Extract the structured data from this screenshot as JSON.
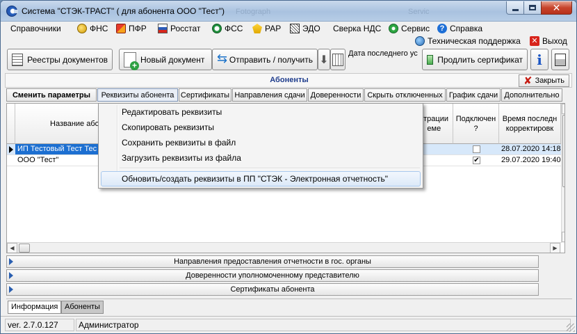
{
  "window": {
    "title": "Система \"СТЭК-ТРАСТ\" ( для абонента ООО \"Тест\")",
    "watermark_left": "Fotograph",
    "watermark_right": "Servic"
  },
  "menu": {
    "items": [
      {
        "label": "Справочники",
        "icon": "book-icon"
      },
      {
        "label": "ФНС",
        "icon": "fns-emblem-icon"
      },
      {
        "label": "ПФР",
        "icon": "pfr-logo-icon"
      },
      {
        "label": "Росстат",
        "icon": "rosstat-logo-icon"
      },
      {
        "label": "ФСС",
        "icon": "fss-logo-icon"
      },
      {
        "label": "РАР",
        "icon": "rar-emblem-icon"
      },
      {
        "label": "ЭДО",
        "icon": "edo-icon"
      },
      {
        "label": "Сверка НДС",
        "icon": ""
      },
      {
        "label": "Сервис",
        "icon": "gear-icon"
      },
      {
        "label": "Справка",
        "icon": "help-icon"
      }
    ],
    "support": "Техническая поддержка",
    "exit": "Выход"
  },
  "toolbar": {
    "registers": "Реестры документов",
    "new_document": "Новый документ",
    "send_receive": "Отправить / получить",
    "last_date_label": "Дата последнего ус",
    "extend_certificate": "Продлить сертификат"
  },
  "panel": {
    "title": "Абоненты",
    "close": "Закрыть"
  },
  "subtabs": [
    "Сменить параметры",
    "Реквизиты абонента",
    "Сертификаты",
    "Направления сдачи",
    "Доверенности",
    "Скрыть отключенных",
    "График сдачи",
    "Дополнительно"
  ],
  "grid": {
    "headers": {
      "name": "Название або",
      "registration": "страции\nеме",
      "connected": "Подключен\n?",
      "modified": "Время последн\nкорректировк"
    },
    "rows": [
      {
        "name": "ИП Тестовый Тест Тес",
        "connected": false,
        "modified": "28.07.2020 14:18",
        "selected": true
      },
      {
        "name": "ООО \"Тест\"",
        "connected": true,
        "modified": "29.07.2020 19:40",
        "selected": false
      }
    ]
  },
  "context_menu": {
    "items": [
      "Редактировать реквизиты",
      "Скопировать реквизиты",
      "Сохранить реквизиты в файл",
      "Загрузить реквизиты из файла"
    ],
    "highlighted": "Обновить/создать реквизиты в ПП \"СТЭК - Электронная отчетность\""
  },
  "accordion": [
    "Направления предоставления отчетности в гос. органы",
    "Доверенности уполномоченному представителю",
    "Сертификаты абонента"
  ],
  "bottom_tabs": {
    "info": "Информация",
    "subscribers": "Абоненты"
  },
  "status": {
    "version": "ver. 2.7.0.127",
    "user": "Администратор"
  },
  "colors": {
    "selection": "#1c6fd1",
    "panel_title": "#1e3c8c",
    "close_red": "#c61c13"
  }
}
